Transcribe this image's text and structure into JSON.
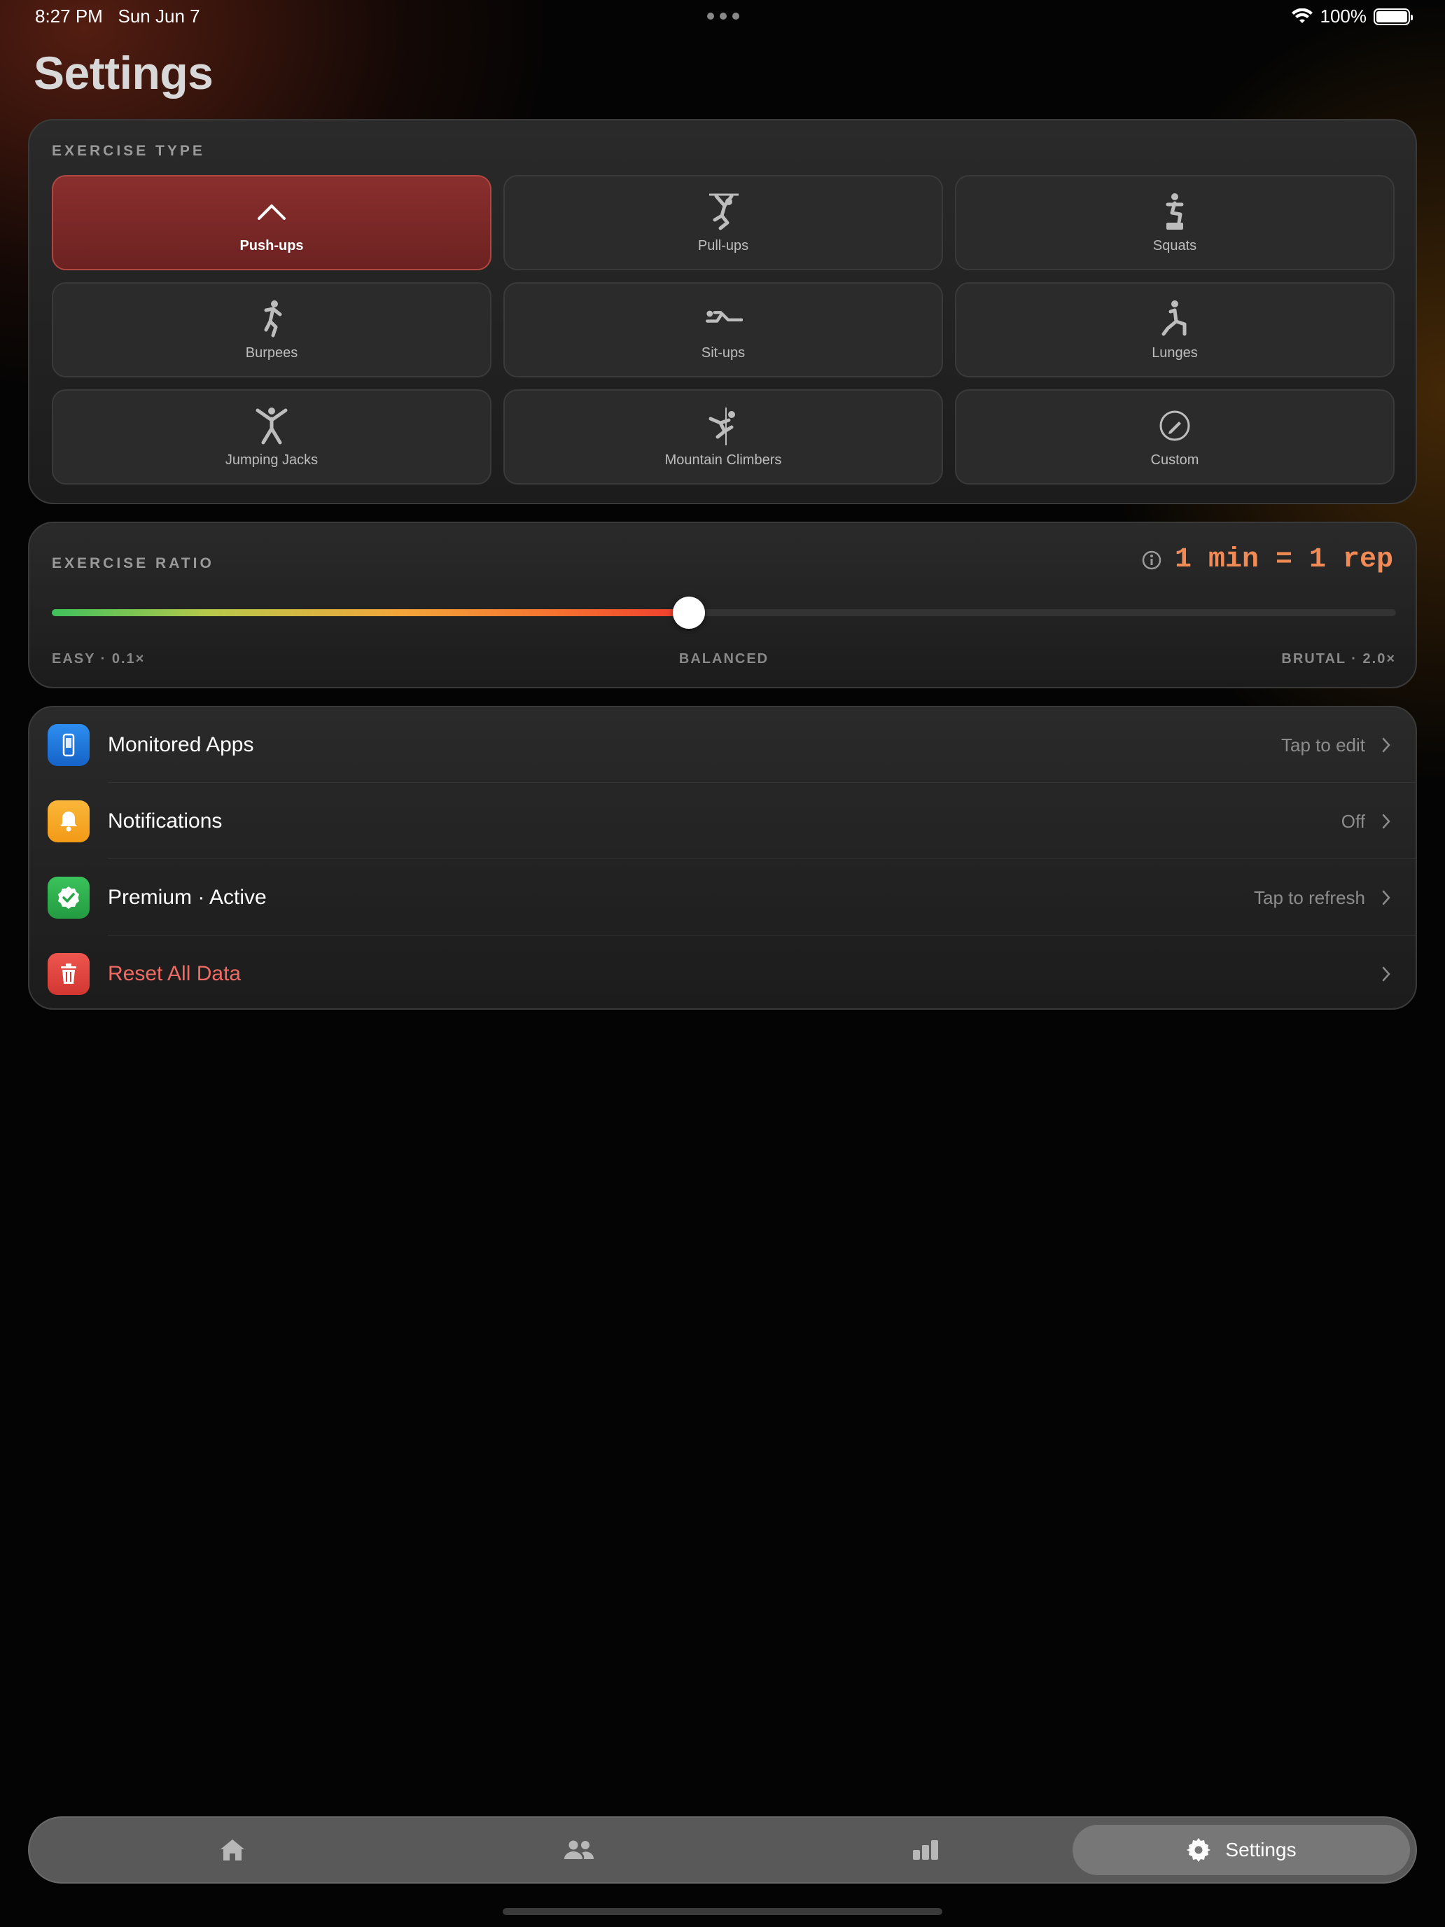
{
  "status_bar": {
    "time": "8:27 PM",
    "date": "Sun Jun 7",
    "battery_percent": "100%",
    "battery_level": 1.0
  },
  "page": {
    "title": "Settings"
  },
  "exercise_type": {
    "label": "EXERCISE TYPE",
    "selected": "Push-ups",
    "items": [
      {
        "label": "Push-ups",
        "icon": "chevron-up-icon"
      },
      {
        "label": "Pull-ups",
        "icon": "pullup-figure-icon"
      },
      {
        "label": "Squats",
        "icon": "squat-figure-icon"
      },
      {
        "label": "Burpees",
        "icon": "burpee-figure-icon"
      },
      {
        "label": "Sit-ups",
        "icon": "situp-figure-icon"
      },
      {
        "label": "Lunges",
        "icon": "lunge-figure-icon"
      },
      {
        "label": "Jumping Jacks",
        "icon": "jumping-jack-figure-icon"
      },
      {
        "label": "Mountain Climbers",
        "icon": "climber-figure-icon"
      },
      {
        "label": "Custom",
        "icon": "pencil-circle-icon"
      }
    ]
  },
  "exercise_ratio": {
    "label": "EXERCISE RATIO",
    "value_text": "1 min = 1 rep",
    "slider_fraction": 0.474,
    "min_label": "EASY · 0.1×",
    "mid_label": "BALANCED",
    "max_label": "BRUTAL · 2.0×",
    "accent": "#f28a55"
  },
  "settings_list": [
    {
      "title": "Monitored Apps",
      "value": "Tap to edit",
      "icon": "phone-icon",
      "color": "#1f7ae6"
    },
    {
      "title": "Notifications",
      "value": "Off",
      "icon": "bell-icon",
      "color": "#f7a928"
    },
    {
      "title": "Premium · Active",
      "value": "Tap to refresh",
      "icon": "verified-badge-icon",
      "color": "#2fb34f"
    },
    {
      "title": "Reset All Data",
      "value": "",
      "icon": "trash-icon",
      "color": "#e0413b"
    }
  ],
  "tab_bar": {
    "tabs": [
      {
        "name": "home",
        "icon": "home-icon"
      },
      {
        "name": "people",
        "icon": "people-icon"
      },
      {
        "name": "stats",
        "icon": "bar-chart-icon"
      },
      {
        "name": "settings",
        "icon": "gear-icon",
        "label": "Settings",
        "active": true
      }
    ]
  }
}
